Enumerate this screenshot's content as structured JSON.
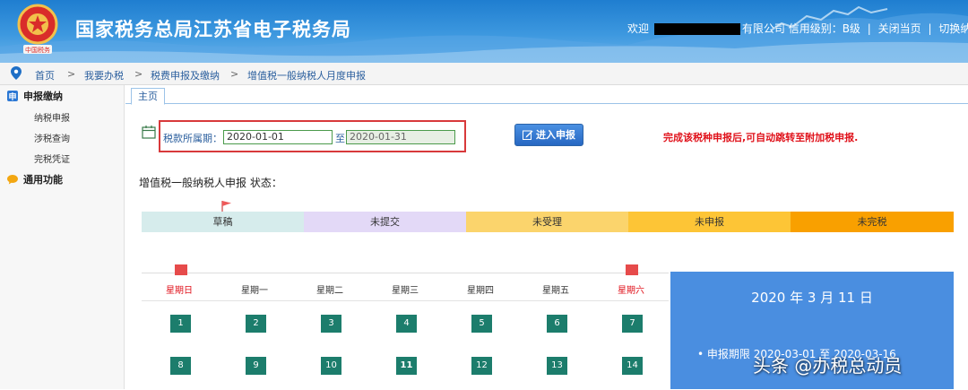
{
  "header": {
    "site_title": "国家税务总局江苏省电子税务局",
    "welcome": "欢迎",
    "company_suffix": "有限公司",
    "credit_level": "信用级别：B级",
    "close_page": "关闭当页",
    "switch": "切换纳"
  },
  "breadcrumb": [
    "首页",
    "我要办税",
    "税费申报及缴纳",
    "增值税一般纳税人月度申报"
  ],
  "sidebar": {
    "section1": "申报缴纳",
    "items": [
      "纳税申报",
      "涉税查询",
      "完税凭证"
    ],
    "section2": "通用功能"
  },
  "tabs": [
    "主页"
  ],
  "period": {
    "label": "税款所属期：",
    "from": "2020-01-01",
    "to_label": "至",
    "to": "2020-01-31"
  },
  "enter_button": "进入申报",
  "notice": "完成该税种申报后,可自动跳转至附加税申报.",
  "status": {
    "title": "增值税一般纳税人申报 状态：",
    "steps": [
      {
        "label": "草稿",
        "color": "#d6ecec"
      },
      {
        "label": "未提交",
        "color": "#e3d9f7"
      },
      {
        "label": "未受理",
        "color": "#fbd46c"
      },
      {
        "label": "未申报",
        "color": "#fdc536"
      },
      {
        "label": "未完税",
        "color": "#f9a000"
      }
    ]
  },
  "calendar": {
    "weekdays": [
      "星期日",
      "星期一",
      "星期二",
      "星期三",
      "星期四",
      "星期五",
      "星期六"
    ],
    "days": [
      "1",
      "2",
      "3",
      "4",
      "5",
      "6",
      "7",
      "8",
      "9",
      "10",
      "11",
      "12",
      "13",
      "14"
    ]
  },
  "info": {
    "date": "2020 年 3 月 11 日",
    "period": "• 申报期限 2020-03-01 至 2020-03-16"
  },
  "watermark": "头条 @办税总动员"
}
